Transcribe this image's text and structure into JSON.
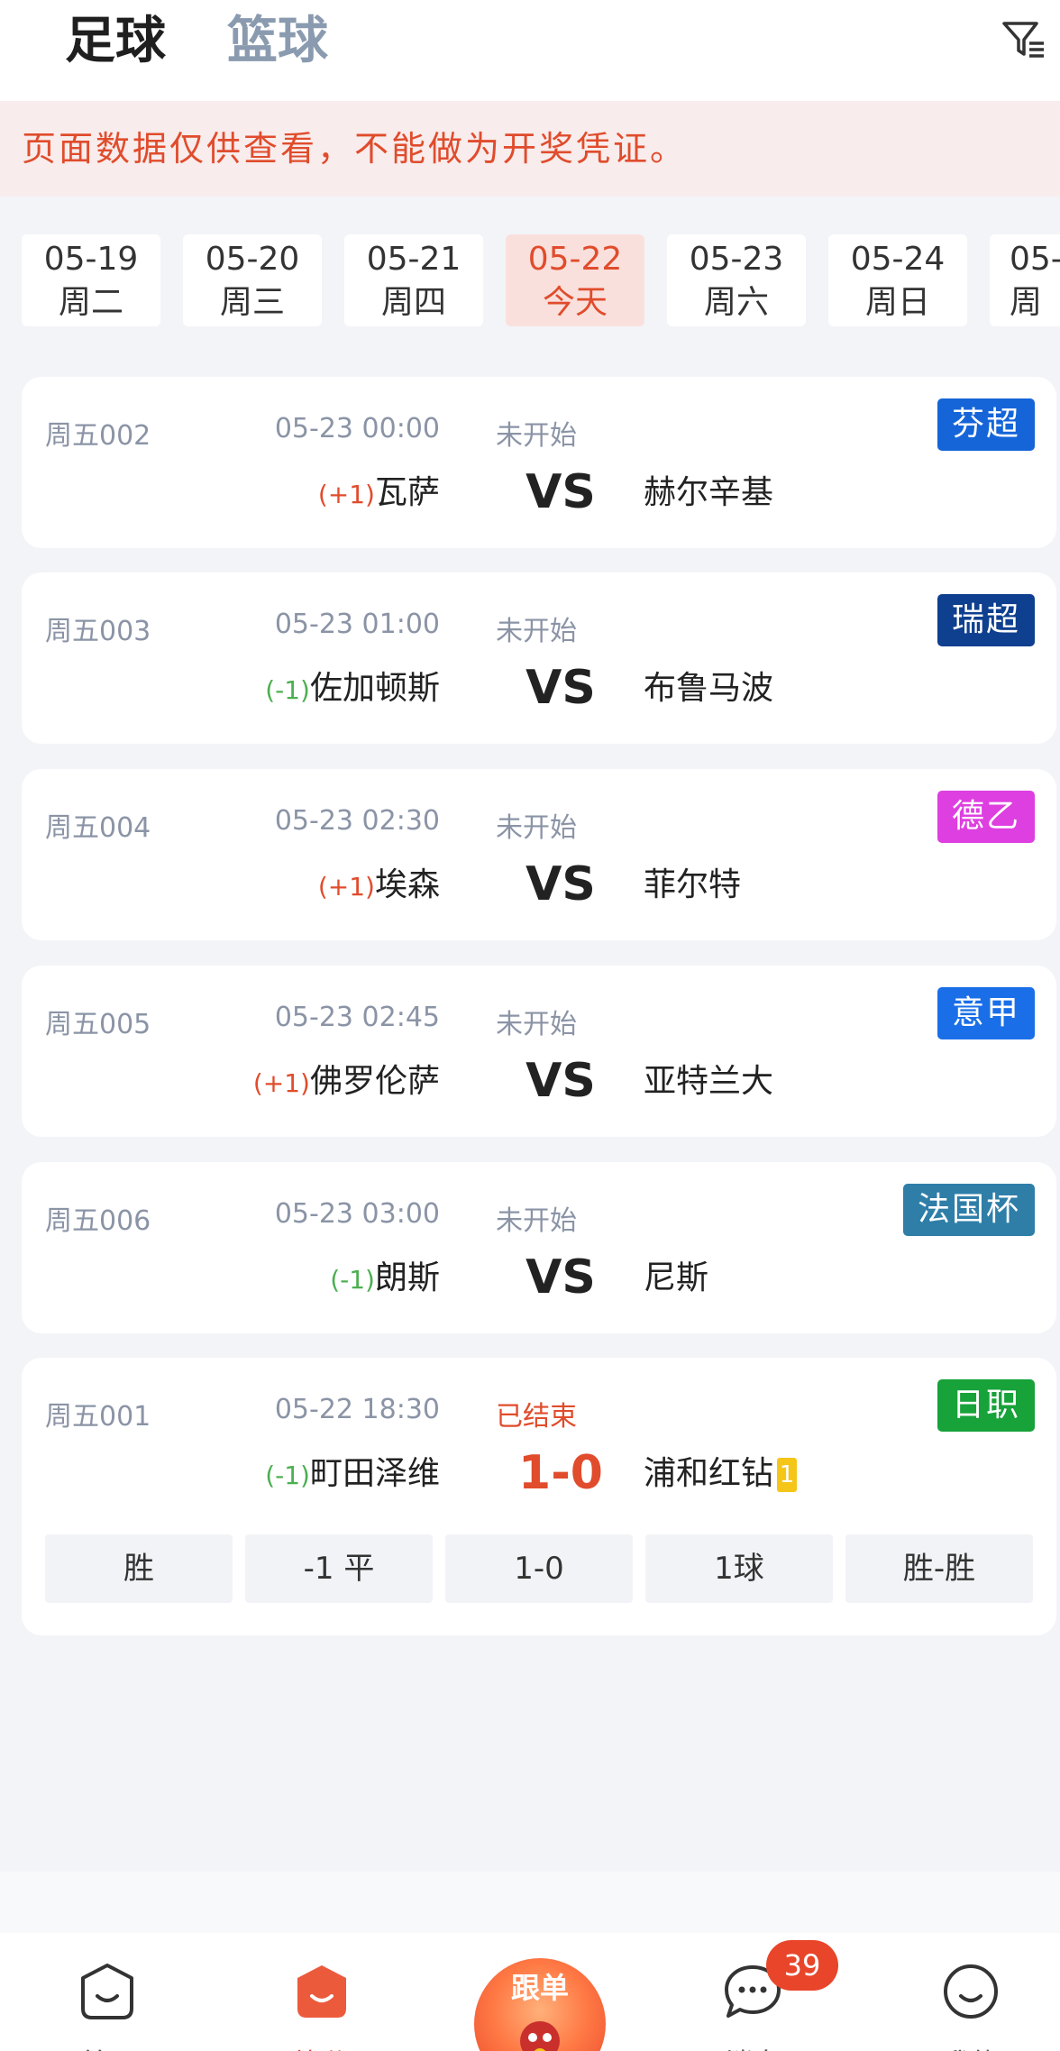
{
  "header": {
    "tabs": [
      {
        "label": "足球",
        "active": true
      },
      {
        "label": "篮球",
        "active": false
      }
    ],
    "filter_icon": "filter-list-icon"
  },
  "notice": "页面数据仅供查看，不能做为开奖凭证。",
  "dates": [
    {
      "date": "05-19",
      "weekday": "周二"
    },
    {
      "date": "05-20",
      "weekday": "周三"
    },
    {
      "date": "05-21",
      "weekday": "周四"
    },
    {
      "date": "05-22",
      "weekday": "今天",
      "selected": true
    },
    {
      "date": "05-23",
      "weekday": "周六"
    },
    {
      "date": "05-24",
      "weekday": "周日"
    },
    {
      "date": "05-",
      "weekday": "周"
    }
  ],
  "matches": [
    {
      "code": "周五002",
      "time": "05-23 00:00",
      "status": "未开始",
      "league": "芬超",
      "league_color": "#1565d8",
      "handicap": "(+1)",
      "home": "瓦萨",
      "center": "VS",
      "away": "赫尔辛基"
    },
    {
      "code": "周五003",
      "time": "05-23 01:00",
      "status": "未开始",
      "league": "瑞超",
      "league_color": "#0f3f8f",
      "handicap": "(-1)",
      "home": "佐加顿斯",
      "center": "VS",
      "away": "布鲁马波"
    },
    {
      "code": "周五004",
      "time": "05-23 02:30",
      "status": "未开始",
      "league": "德乙",
      "league_color": "#de3fe0",
      "handicap": "(+1)",
      "home": "埃森",
      "center": "VS",
      "away": "菲尔特"
    },
    {
      "code": "周五005",
      "time": "05-23 02:45",
      "status": "未开始",
      "league": "意甲",
      "league_color": "#1a6fe8",
      "handicap": "(+1)",
      "home": "佛罗伦萨",
      "center": "VS",
      "away": "亚特兰大"
    },
    {
      "code": "周五006",
      "time": "05-23 03:00",
      "status": "未开始",
      "league": "法国杯",
      "league_color": "#2e7ea8",
      "handicap": "(-1)",
      "home": "朗斯",
      "center": "VS",
      "away": "尼斯"
    },
    {
      "code": "周五001",
      "time": "05-22 18:30",
      "status": "已结束",
      "league": "日职",
      "league_color": "#17a23a",
      "handicap": "(-1)",
      "home": "町田泽维",
      "center": "1-0",
      "away": "浦和红钻",
      "away_card": "1",
      "results": [
        "胜",
        "-1 平",
        "1-0",
        "1球",
        "胜-胜"
      ]
    }
  ],
  "tabbar": {
    "items": [
      {
        "label": "首页",
        "icon": "home-icon"
      },
      {
        "label": "比分",
        "icon": "score-icon",
        "active": true
      },
      {
        "label": "跟单",
        "icon": "follow-icon"
      },
      {
        "label": "消息",
        "icon": "message-icon",
        "badge": "39"
      },
      {
        "label": "我的",
        "icon": "profile-icon"
      }
    ]
  }
}
